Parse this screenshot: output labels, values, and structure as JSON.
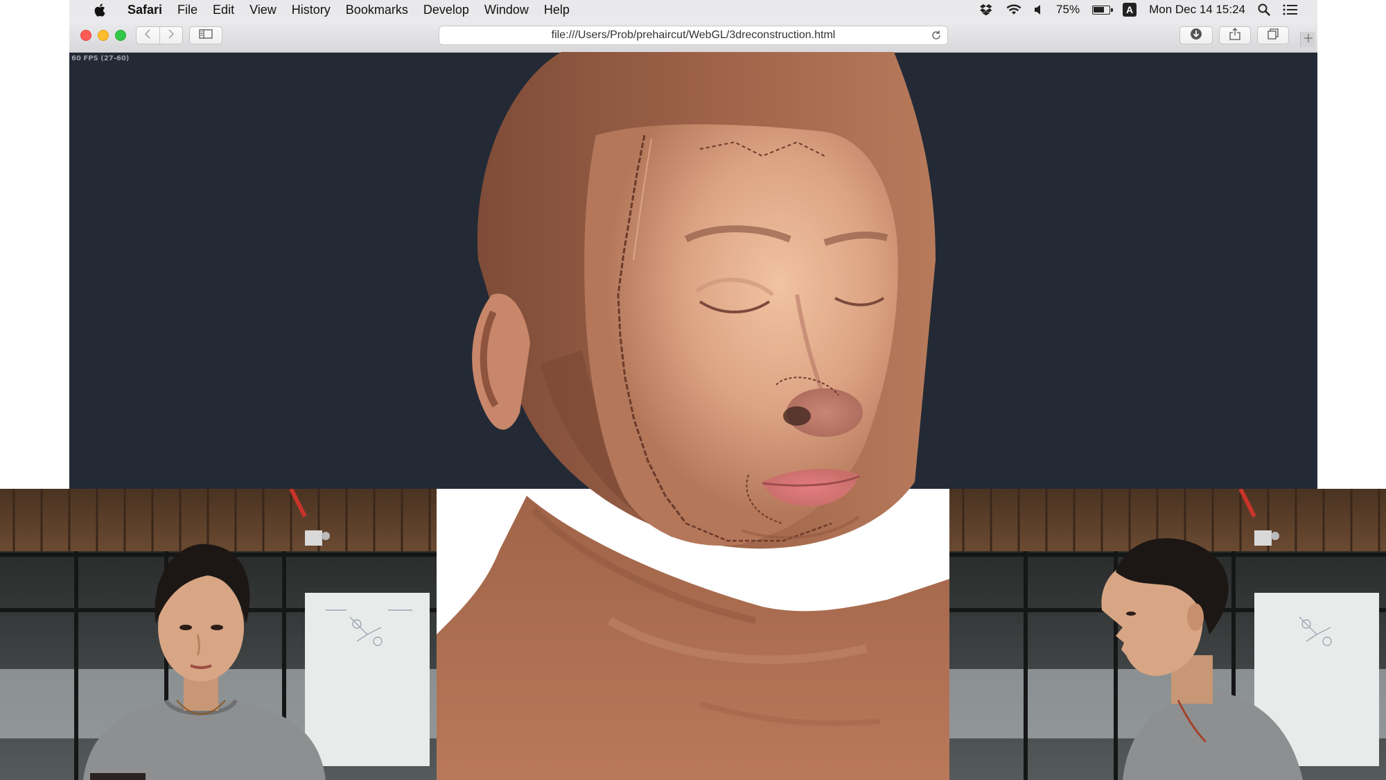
{
  "menubar": {
    "app_name": "Safari",
    "items": [
      "File",
      "Edit",
      "View",
      "History",
      "Bookmarks",
      "Develop",
      "Window",
      "Help"
    ],
    "battery_percent": "75%",
    "battery_level": 0.75,
    "input_source": "A",
    "datetime": "Mon Dec 14  15:24",
    "status_icons": [
      "dropbox-icon",
      "wifi-icon",
      "volume-icon",
      "battery-icon",
      "input-source-icon",
      "spotlight-icon",
      "notification-center-icon"
    ]
  },
  "toolbar": {
    "url": "file:///Users/Prob/prehaircut/WebGL/3dreconstruction.html",
    "icons": [
      "back-icon",
      "forward-icon",
      "sidebar-icon",
      "reload-icon",
      "download-icon",
      "share-icon",
      "tabs-icon",
      "new-tab-icon"
    ]
  },
  "canvas": {
    "fps_text": "60 FPS (27-60)",
    "background": "#232a35",
    "render": "3d-reconstructed-face-mesh"
  },
  "webcams": {
    "front": "webcam-front-view",
    "side": "webcam-side-profile"
  },
  "colors": {
    "screen_bg": "#232a35",
    "skin": "#b06e52",
    "skin_highlight": "#e5b08f",
    "lips": "#d86b6f"
  }
}
